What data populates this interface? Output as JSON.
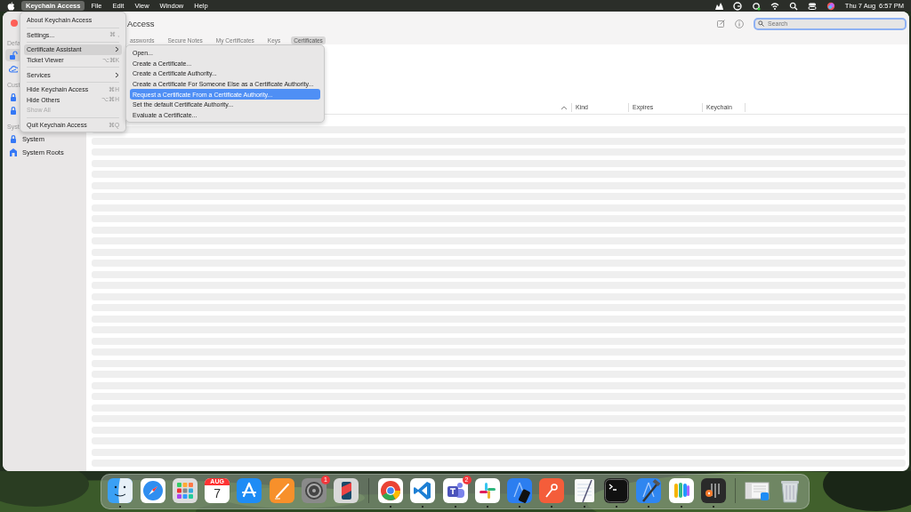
{
  "menubar": {
    "items": [
      {
        "label": "Keychain Access",
        "selected": true
      },
      {
        "label": "File",
        "selected": false
      },
      {
        "label": "Edit",
        "selected": false
      },
      {
        "label": "View",
        "selected": false
      },
      {
        "label": "Window",
        "selected": false
      },
      {
        "label": "Help",
        "selected": false
      }
    ],
    "date": "Thu 7 Aug",
    "time": "6:57 PM"
  },
  "window": {
    "title": "Access",
    "search": {
      "placeholder": "Search",
      "focused": true
    },
    "tabs": [
      {
        "label": "asswords",
        "selected": false
      },
      {
        "label": "Secure Notes",
        "selected": false
      },
      {
        "label": "My Certificates",
        "selected": false
      },
      {
        "label": "Keys",
        "selected": false
      },
      {
        "label": "Certificates",
        "selected": true
      }
    ],
    "sidebar": {
      "sections": [
        {
          "heading": "Defa",
          "items": [
            {
              "kind": "unlocked",
              "selected": true
            },
            {
              "kind": "cloud",
              "selected": false
            }
          ]
        },
        {
          "heading": "Cust",
          "items": [
            {
              "kind": "lock",
              "selected": false
            },
            {
              "kind": "lock",
              "selected": false
            }
          ]
        },
        {
          "heading": "Syst",
          "items": [
            {
              "kind": "lock",
              "label": "System",
              "selected": false
            },
            {
              "kind": "building",
              "label": "System Roots",
              "selected": false
            }
          ]
        }
      ]
    },
    "table": {
      "ascending": true,
      "columns": [
        "Kind",
        "Expires",
        "Keychain"
      ]
    }
  },
  "app_menu": {
    "items": [
      {
        "kind": "item",
        "label": "About Keychain Access",
        "selected": false,
        "disabled": false
      },
      {
        "kind": "separator"
      },
      {
        "kind": "item",
        "label": "Settings...",
        "shortcut": "⌘ ,",
        "selected": false,
        "disabled": false
      },
      {
        "kind": "separator"
      },
      {
        "kind": "item",
        "label": "Certificate Assistant",
        "submenu": true,
        "selected": true,
        "disabled": false
      },
      {
        "kind": "item",
        "label": "Ticket Viewer",
        "shortcut": "⌥⌘K",
        "selected": false,
        "disabled": false
      },
      {
        "kind": "separator"
      },
      {
        "kind": "item",
        "label": "Services",
        "submenu": true,
        "selected": false,
        "disabled": false
      },
      {
        "kind": "separator"
      },
      {
        "kind": "item",
        "label": "Hide Keychain Access",
        "shortcut": "⌘H",
        "selected": false,
        "disabled": false
      },
      {
        "kind": "item",
        "label": "Hide Others",
        "shortcut": "⌥⌘H",
        "selected": false,
        "disabled": false
      },
      {
        "kind": "item",
        "label": "Show All",
        "selected": false,
        "disabled": true
      },
      {
        "kind": "separator"
      },
      {
        "kind": "item",
        "label": "Quit Keychain Access",
        "shortcut": "⌘Q",
        "selected": false,
        "disabled": false
      }
    ]
  },
  "submenu": {
    "items": [
      {
        "kind": "item",
        "label": "Open...",
        "selected": false,
        "disabled": false
      },
      {
        "kind": "item",
        "label": "Create a Certificate...",
        "selected": false,
        "disabled": false
      },
      {
        "kind": "item",
        "label": "Create a Certificate Authority...",
        "selected": false,
        "disabled": false
      },
      {
        "kind": "item",
        "label": "Create a Certificate For Someone Else as a Certificate Authority...",
        "selected": false,
        "disabled": false
      },
      {
        "kind": "item",
        "label": "Request a Certificate From a Certificate Authority...",
        "selected": true,
        "disabled": false
      },
      {
        "kind": "item",
        "label": "Set the default Certificate Authority...",
        "selected": false,
        "disabled": false
      },
      {
        "kind": "item",
        "label": "Evaluate a Certificate...",
        "selected": false,
        "disabled": false
      }
    ]
  },
  "dock": {
    "items": [
      {
        "kind": "finder",
        "running": true
      },
      {
        "kind": "safari",
        "running": false
      },
      {
        "kind": "launchpad",
        "running": false
      },
      {
        "kind": "calendar",
        "month": "AUG",
        "day": "7",
        "running": false
      },
      {
        "kind": "appstore",
        "running": false
      },
      {
        "kind": "pen",
        "running": false
      },
      {
        "kind": "settings",
        "badge": "1",
        "running": false
      },
      {
        "kind": "phone",
        "running": false
      },
      {
        "kind": "divider"
      },
      {
        "kind": "chrome",
        "running": true
      },
      {
        "kind": "vscode",
        "running": true
      },
      {
        "kind": "teams",
        "badge": "2",
        "running": true
      },
      {
        "kind": "slack",
        "running": true
      },
      {
        "kind": "simulator",
        "running": true
      },
      {
        "kind": "postman",
        "running": true
      },
      {
        "kind": "textedit",
        "running": true
      },
      {
        "kind": "terminal",
        "running": true
      },
      {
        "kind": "xcode",
        "running": true
      },
      {
        "kind": "passwords",
        "running": true
      },
      {
        "kind": "keychain",
        "running": true
      },
      {
        "kind": "divider"
      },
      {
        "kind": "thumbnail",
        "running": false
      },
      {
        "kind": "trash",
        "running": false
      }
    ]
  }
}
